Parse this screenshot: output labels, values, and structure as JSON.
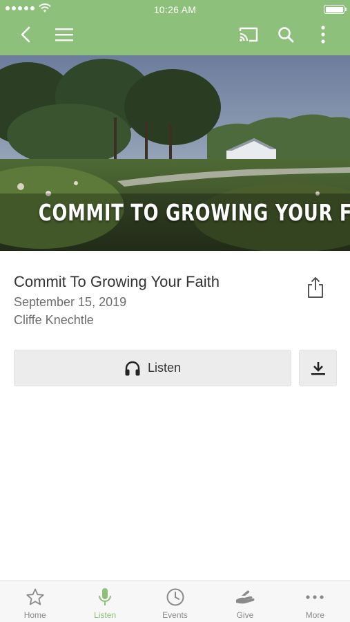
{
  "status_bar": {
    "time": "10:26 AM"
  },
  "nav": {
    "back_icon": "chevron-left-icon",
    "menu_icon": "hamburger-icon",
    "cast_icon": "cast-icon",
    "search_icon": "search-icon",
    "more_icon": "vertical-dots-icon"
  },
  "hero": {
    "banner_text": "COMMIT TO GROWING YOUR FAITH"
  },
  "sermon": {
    "title": "Commit To Growing Your Faith",
    "date": "September 15, 2019",
    "speaker": "Cliffe Knechtle"
  },
  "actions": {
    "listen_label": "Listen",
    "listen_icon": "headphones-icon",
    "download_icon": "download-icon",
    "share_icon": "share-icon"
  },
  "tabs": [
    {
      "label": "Home",
      "icon": "star-icon"
    },
    {
      "label": "Listen",
      "icon": "microphone-icon",
      "active": true
    },
    {
      "label": "Events",
      "icon": "clock-icon"
    },
    {
      "label": "Give",
      "icon": "giving-hand-icon"
    },
    {
      "label": "More",
      "icon": "horizontal-dots-icon"
    }
  ],
  "colors": {
    "brand_green": "#8dc07a",
    "tab_inactive": "#8a8a8a",
    "button_bg": "#ececec"
  }
}
